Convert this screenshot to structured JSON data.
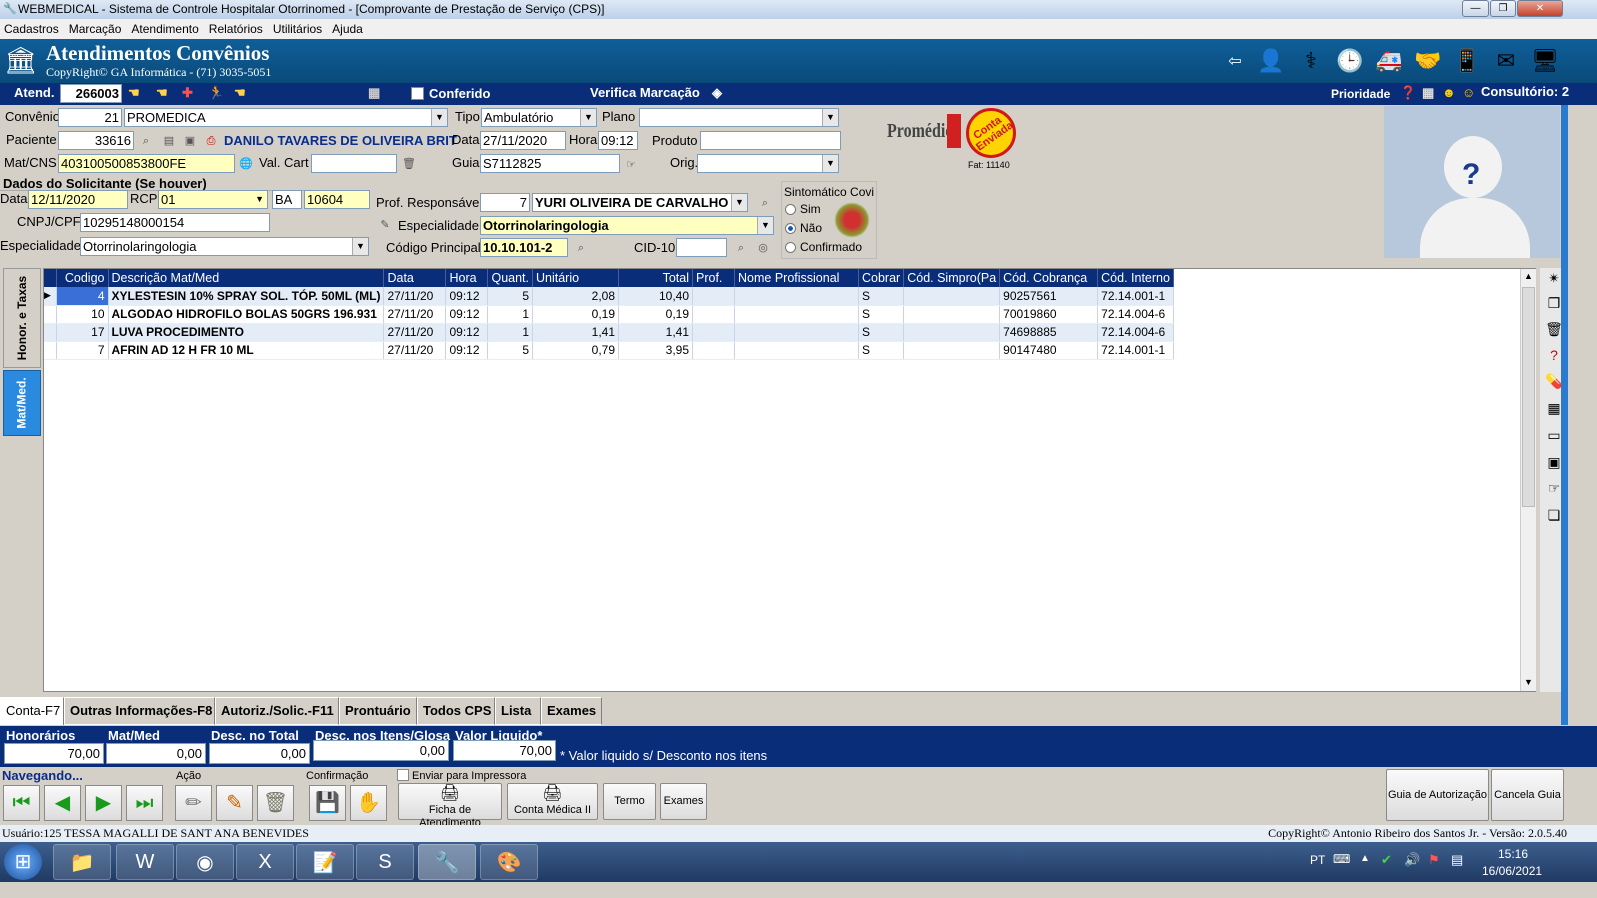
{
  "window": {
    "title": "WEBMEDICAL - Sistema de Controle Hospitalar Otorrinomed - [Comprovante de Prestação de Serviço  (CPS)]",
    "controls": [
      "—",
      "❐",
      "✕"
    ]
  },
  "menu": [
    "Cadastros",
    "Marcação",
    "Atendimento",
    "Relatórios",
    "Utilitários",
    "Ajuda"
  ],
  "banner": {
    "title": "Atendimentos Convênios",
    "copyright": "CopyRight© GA Informática - (71) 3035-5051"
  },
  "atend": {
    "label": "Atend.",
    "number": "266003",
    "conferido": "Conferido",
    "verifica": "Verifica Marcação",
    "prioridade": "Prioridade",
    "consultorio": "Consultório: 2"
  },
  "form": {
    "convenio_label": "Convênio",
    "convenio_code": "21",
    "convenio_name": "PROMEDICA",
    "tipo_label": "Tipo",
    "tipo_value": "Ambulatório",
    "plano_label": "Plano",
    "plano_value": "",
    "paciente_label": "Paciente",
    "paciente_code": "33616",
    "paciente_name": "DANILO TAVARES DE OLIVEIRA BRIT",
    "data_label": "Data",
    "data_value": "27/11/2020",
    "hora_label": "Hora",
    "hora_value": "09:12",
    "produto_label": "Produto",
    "produto_value": "",
    "matcns_label": "Mat/CNS",
    "matcns_value": "403100500853800FE",
    "valcart_label": "Val. Cart",
    "valcart_value": "",
    "guia_label": "Guia",
    "guia_value": "S7112825",
    "orig_label": "Orig.",
    "orig_value": "",
    "solicitante_title": "Dados do Solicitante (Se houver)",
    "sol_data_label": "Data",
    "sol_data_value": "12/11/2020",
    "rcp_label": "RCP",
    "rcp_value": "01",
    "uf_value": "BA",
    "crm_value": "10604",
    "cnpj_label": "CNPJ/CPF",
    "cnpj_value": "10295148000154",
    "esp_label": "Especialidade",
    "esp_value": "Otorrinolaringologia",
    "prof_label": "Prof. Responsável",
    "prof_code": "7",
    "prof_name": "YURI OLIVEIRA DE CARVALHO",
    "esp2_label": "Especialidade",
    "esp2_value": "Otorrinolaringologia",
    "codprinc_label": "Código Principal",
    "codprinc_value": "10.10.101-2",
    "cid_label": "CID-10",
    "cid_value": "",
    "sint_title": "Sintomático Covi",
    "sint_options": [
      "Sim",
      "Não",
      "Confirmado"
    ],
    "logo_brand": "Promédica",
    "stamp": "Conta Enviada",
    "fat": "Fat: 11140"
  },
  "vtabs": [
    "Honor. e Taxas",
    "Mat/Med."
  ],
  "grid": {
    "columns": [
      "Codigo",
      "Descrição Mat/Med",
      "Data",
      "Hora",
      "Quant.",
      "Unitário",
      "Total",
      "Prof.",
      "Nome Profissional",
      "Cobrar",
      "Cód. Simpro(Pa",
      "Cód. Cobrança",
      "Cód. Interno"
    ],
    "rows": [
      [
        "4",
        "XYLESTESIN 10% SPRAY SOL. TÓP. 50ML (ML)",
        "27/11/20",
        "09:12",
        "5",
        "2,08",
        "10,40",
        "",
        "",
        "S",
        "",
        "90257561",
        "72.14.001-1"
      ],
      [
        "10",
        "ALGODAO HIDROFILO BOLAS 50GRS 196.931",
        "27/11/20",
        "09:12",
        "1",
        "0,19",
        "0,19",
        "",
        "",
        "S",
        "",
        "70019860",
        "72.14.004-6"
      ],
      [
        "17",
        "LUVA PROCEDIMENTO",
        "27/11/20",
        "09:12",
        "1",
        "1,41",
        "1,41",
        "",
        "",
        "S",
        "",
        "74698885",
        "72.14.004-6"
      ],
      [
        "7",
        "AFRIN AD  12 H FR  10 ML",
        "27/11/20",
        "09:12",
        "5",
        "0,79",
        "3,95",
        "",
        "",
        "S",
        "",
        "90147480",
        "72.14.001-1"
      ]
    ]
  },
  "tabs": [
    "Conta-F7",
    "Outras Informações-F8",
    "Autoriz./Solic.-F11",
    "Prontuário",
    "Todos CPS",
    "Lista",
    "Exames"
  ],
  "totals": {
    "honorarios_label": "Honorários",
    "honorarios": "70,00",
    "matmed_label": "Mat/Med",
    "matmed": "0,00",
    "desc_total_label": "Desc. no Total",
    "desc_total": "0,00",
    "desc_itens_label": "Desc. nos Itens/Glosa",
    "desc_itens": "0,00",
    "liquido_label": "Valor Liquido*",
    "liquido": "70,00",
    "note": "* Valor liquido s/ Desconto nos itens"
  },
  "actions": {
    "navegando": "Navegando...",
    "acao": "Ação",
    "confirmacao": "Confirmação",
    "enviar": "Enviar para Impressora",
    "ficha": "Ficha de Atendimento",
    "conta2": "Conta Médica II",
    "termo": "Termo",
    "exames": "Exames",
    "guia_aut": "Guia de Autorização",
    "cancela": "Cancela Guia"
  },
  "status": {
    "user": "Usuário:125 TESSA MAGALLI DE SANT ANA BENEVIDES",
    "copyright": "CopyRight© Antonio Ribeiro dos Santos Jr. - Versão: 2.0.5.40"
  },
  "taskbar": {
    "lang": "PT",
    "time": "15:16",
    "date": "16/06/2021"
  },
  "colors": {
    "header": "#0a2d7a",
    "banner": "#0f5f99",
    "yellow_field": "#ffffc0",
    "selected_row": "#3a6fd8"
  }
}
